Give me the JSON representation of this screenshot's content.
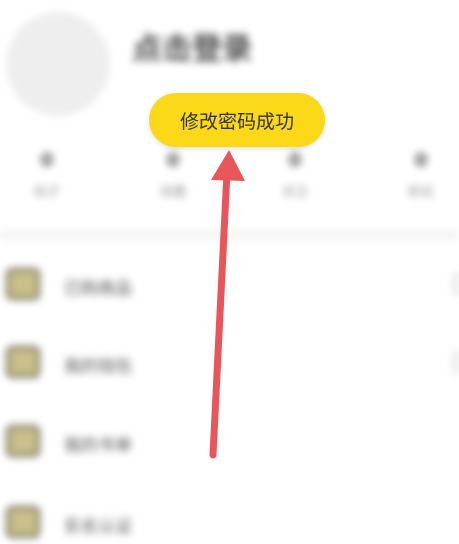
{
  "profile": {
    "login_prompt": "点击登录"
  },
  "stats": [
    {
      "value": "0",
      "label": "帖子"
    },
    {
      "value": "0",
      "label": "收藏"
    },
    {
      "value": "0",
      "label": "关注"
    },
    {
      "value": "0",
      "label": "粉丝"
    }
  ],
  "menu": [
    {
      "label": "已购商品"
    },
    {
      "label": "我的钱包"
    },
    {
      "label": "我的书单"
    },
    {
      "label": "实名认证"
    }
  ],
  "toast": {
    "message": "修改密码成功"
  },
  "colors": {
    "toast_background": "#fbd919",
    "arrow": "#e8555a"
  }
}
